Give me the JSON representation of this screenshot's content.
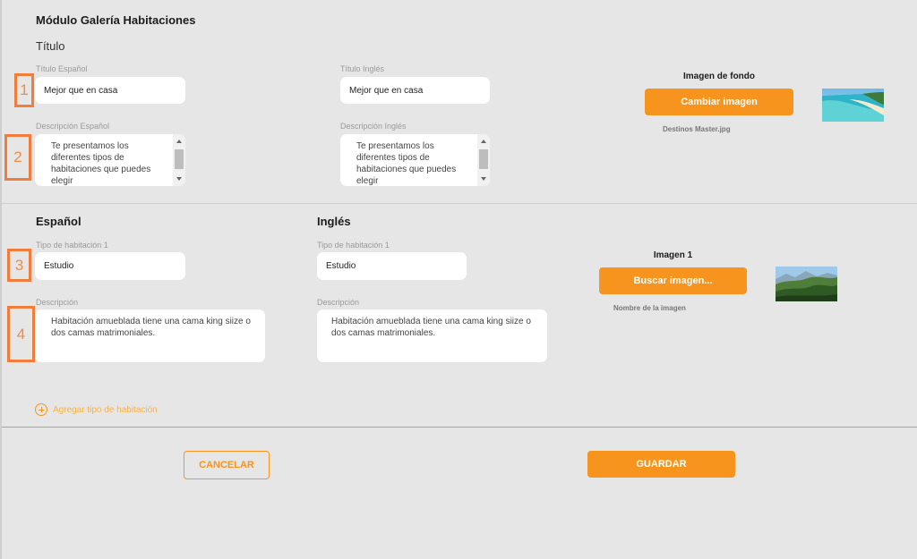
{
  "module": {
    "title": "Módulo Galería Habitaciones",
    "section_title": "Título"
  },
  "header_fields": {
    "title_es_label": "Título Español",
    "title_es_value": "Mejor que en casa",
    "title_en_label": "Título Inglés",
    "title_en_value": "Mejor que en casa",
    "desc_es_label": "Descripción Español",
    "desc_es_value": "Te presentamos los diferentes tipos de habitaciones que puedes elegir",
    "desc_en_label": "Descripción Inglés",
    "desc_en_value": "Te presentamos los diferentes tipos de habitaciones que puedes elegir"
  },
  "background_image": {
    "label": "Imagen de fondo",
    "button_label": "Cambiar imagen",
    "filename": "Destinos Master.jpg"
  },
  "rooms": {
    "spanish_heading": "Español",
    "english_heading": "Inglés",
    "room_type_es_label": "Tipo de habitación 1",
    "room_type_es_value": "Estudio",
    "room_type_en_label": "Tipo de habitación 1",
    "room_type_en_value": "Estudio",
    "desc_es_label": "Descripción",
    "desc_es_value": "Habitación amueblada tiene una cama king siize o dos camas matrimoniales.",
    "desc_en_label": "Descripción",
    "desc_en_value": "Habitación amueblada tiene una cama king siize o dos camas matrimoniales.",
    "image_label": "Imagen 1",
    "image_button_label": "Buscar imagen...",
    "image_filename": "Nombre de la imagen",
    "add_room_label": "Agregar tipo de habitación"
  },
  "markers": [
    "1",
    "2",
    "3",
    "4"
  ],
  "actions": {
    "cancel_label": "CANCELAR",
    "save_label": "GUARDAR"
  },
  "colors": {
    "accent": "#f7941d",
    "marker": "#f07d3c",
    "background": "#e6e6e6"
  }
}
